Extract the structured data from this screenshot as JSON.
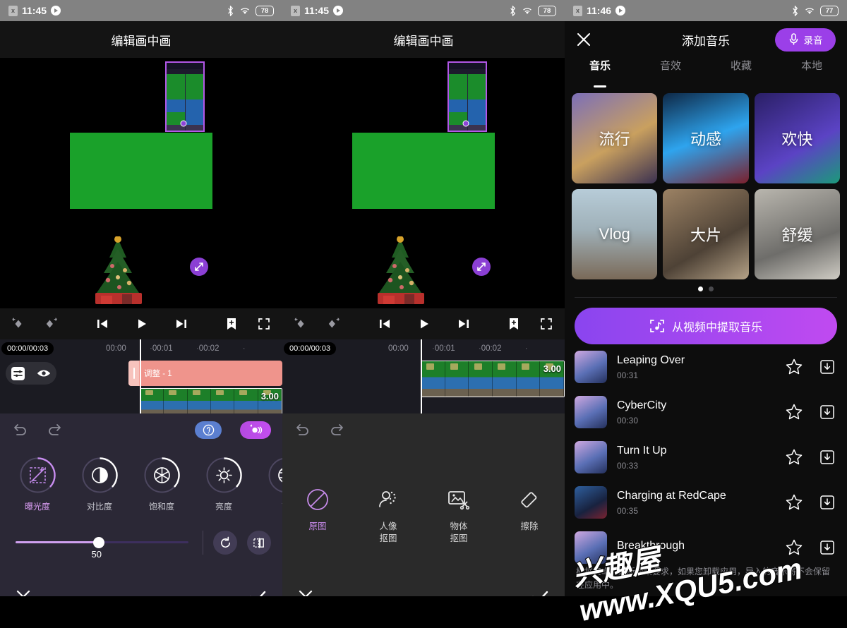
{
  "panels": {
    "p1": {
      "status": {
        "time": "11:45",
        "battery": "78",
        "sim": "x"
      },
      "title": "编辑画中画",
      "timeline": {
        "timecode": "00:00/00:03",
        "marks": [
          "00:00",
          "00:01",
          "00:02"
        ],
        "adjust_clip_label": "调整 - 1",
        "clip_duration": "3.00"
      },
      "adjust": {
        "items": [
          {
            "label": "曝光度",
            "value": 50,
            "icon": "exposure-icon",
            "active": true
          },
          {
            "label": "对比度",
            "value": 50,
            "icon": "contrast-icon",
            "active": false
          },
          {
            "label": "饱和度",
            "value": 50,
            "icon": "saturation-icon",
            "active": false
          },
          {
            "label": "亮度",
            "value": 50,
            "icon": "brightness-icon",
            "active": false
          },
          {
            "label": "高",
            "value": 50,
            "icon": "highlight-icon",
            "active": false
          }
        ],
        "slider_value": "50"
      }
    },
    "p2": {
      "status": {
        "time": "11:45",
        "battery": "78",
        "sim": "x"
      },
      "title": "编辑画中画",
      "timeline": {
        "timecode": "00:00/00:03",
        "marks": [
          "00:00",
          "00:01",
          "00:02"
        ],
        "clip_duration": "3.00"
      },
      "cutout": {
        "items": [
          {
            "label": "原图",
            "icon": "no-effect-icon",
            "active": true
          },
          {
            "label": "人像\n抠图",
            "icon": "portrait-cutout-icon",
            "active": false
          },
          {
            "label": "物体\n抠图",
            "icon": "object-cutout-icon",
            "active": false
          },
          {
            "label": "擦除",
            "icon": "eraser-icon",
            "active": false
          }
        ]
      }
    },
    "p3": {
      "status": {
        "time": "11:46",
        "battery": "77",
        "sim": "x"
      },
      "title": "添加音乐",
      "record_label": "录音",
      "tabs": [
        {
          "label": "音乐",
          "active": true
        },
        {
          "label": "音效",
          "active": false
        },
        {
          "label": "收藏",
          "active": false
        },
        {
          "label": "本地",
          "active": false
        }
      ],
      "categories": [
        {
          "label": "流行",
          "c1": "#6a5fa8",
          "c2": "#d6a65f"
        },
        {
          "label": "动感",
          "c1": "#123a63",
          "c2": "#2ba0e8"
        },
        {
          "label": "欢快",
          "c1": "#2a1f66",
          "c2": "#5b43c4"
        },
        {
          "label": "Vlog",
          "c1": "#9fb7c4",
          "c2": "#7a6a58"
        },
        {
          "label": "大片",
          "c1": "#6f5a45",
          "c2": "#c0a98c"
        },
        {
          "label": "舒缓",
          "c1": "#8e8d88",
          "c2": "#d8d6cf"
        }
      ],
      "page_dots": 2,
      "page_active": 0,
      "extract_label": "从视频中提取音乐",
      "songs": [
        {
          "title": "Leaping Over",
          "duration": "00:31",
          "c1": "#5a6fb5",
          "c2": "#c9a8dd"
        },
        {
          "title": "CyberCity",
          "duration": "00:30",
          "c1": "#5a6fb5",
          "c2": "#c9a8dd"
        },
        {
          "title": "Turn It Up",
          "duration": "00:33",
          "c1": "#5a6fb5",
          "c2": "#c9a8dd"
        },
        {
          "title": "Charging at RedCape",
          "duration": "00:35",
          "c1": "#1b2a4a",
          "c2": "#3f7fc4"
        },
        {
          "title": "Breakthrough",
          "duration": "",
          "c1": "#5a6fb5",
          "c2": "#c9a8dd"
        }
      ],
      "notice": "根据安卓的最新政策要求，如果您卸载应用，导入的音乐将不会保留在应用中。"
    }
  },
  "watermark": {
    "line1": "兴趣屋 www.XQU5.com",
    "line2": ""
  },
  "colors": {
    "accent_purple": "#9b3fe8",
    "adjust_clip": "#ef948c",
    "tab_active": "#ffffff"
  }
}
